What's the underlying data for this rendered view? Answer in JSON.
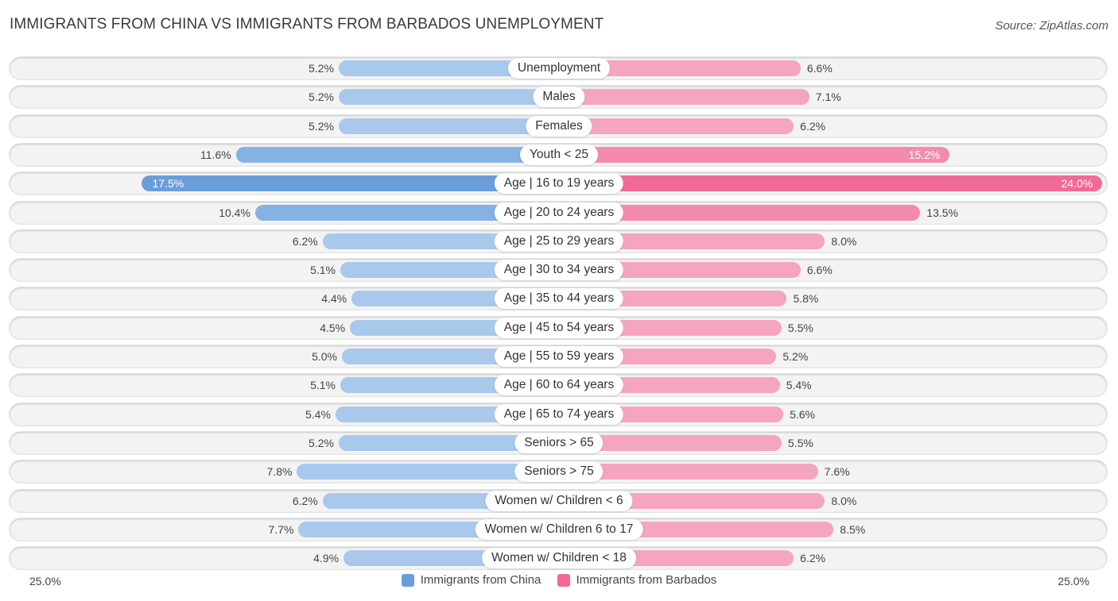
{
  "chart_data": {
    "type": "bar",
    "orientation": "horizontal-diverging",
    "title": "IMMIGRANTS FROM CHINA VS IMMIGRANTS FROM BARBADOS UNEMPLOYMENT",
    "source": "Source: ZipAtlas.com",
    "categories": [
      "Unemployment",
      "Males",
      "Females",
      "Youth < 25",
      "Age | 16 to 19 years",
      "Age | 20 to 24 years",
      "Age | 25 to 29 years",
      "Age | 30 to 34 years",
      "Age | 35 to 44 years",
      "Age | 45 to 54 years",
      "Age | 55 to 59 years",
      "Age | 60 to 64 years",
      "Age | 65 to 74 years",
      "Seniors > 65",
      "Seniors > 75",
      "Women w/ Children < 6",
      "Women w/ Children 6 to 17",
      "Women w/ Children < 18"
    ],
    "series": [
      {
        "name": "Immigrants from China",
        "color": "#6a9edb",
        "values": [
          5.2,
          5.2,
          5.2,
          11.6,
          17.5,
          10.4,
          6.2,
          5.1,
          4.4,
          4.5,
          5.0,
          5.1,
          5.4,
          5.2,
          7.8,
          6.2,
          7.7,
          4.9
        ]
      },
      {
        "name": "Immigrants from Barbados",
        "color": "#f06a95",
        "values": [
          6.6,
          7.1,
          6.2,
          15.2,
          24.0,
          13.5,
          8.0,
          6.6,
          5.8,
          5.5,
          5.2,
          5.4,
          5.6,
          5.5,
          7.6,
          8.0,
          8.5,
          6.2
        ]
      }
    ],
    "value_suffix": "%",
    "axis_left_label": "25.0%",
    "axis_right_label": "25.0%",
    "xlim": [
      0,
      25
    ],
    "legend_position": "bottom-center"
  }
}
